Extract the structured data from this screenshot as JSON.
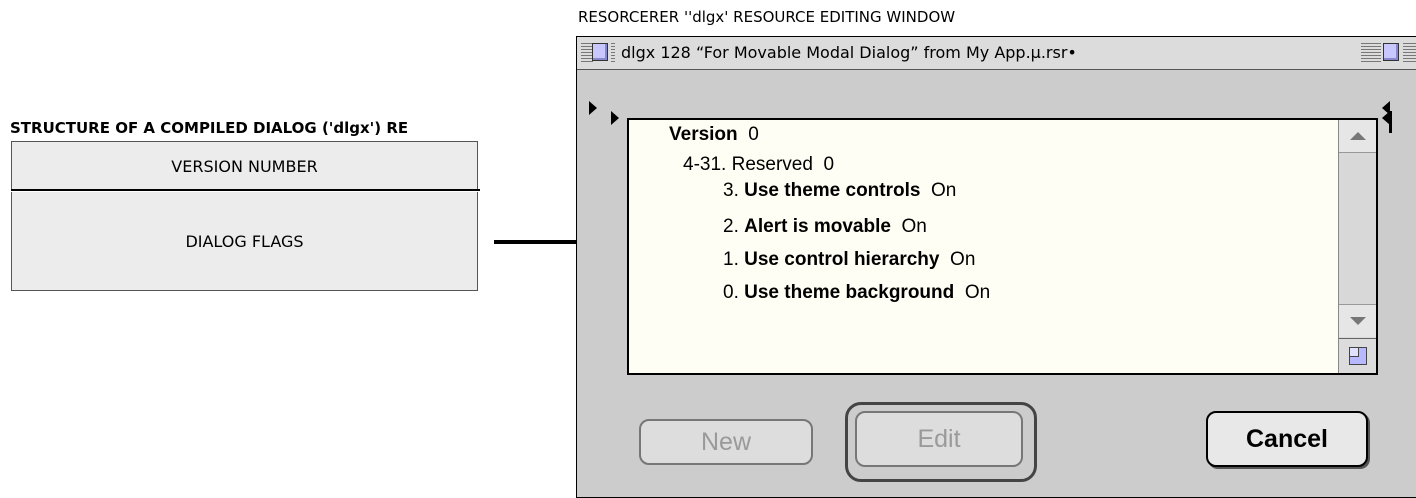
{
  "structure": {
    "title": "STRUCTURE OF A COMPILED DIALOG ('dlgx') RE",
    "fields": [
      "VERSION NUMBER",
      "DIALOG FLAGS"
    ]
  },
  "window_caption": "RESORCERER ''dlgx' RESOURCE EDITING WINDOW",
  "window": {
    "title": "dlgx 128 “For Movable Modal Dialog” from My App.µ.rsr•",
    "lines": [
      {
        "num": "",
        "label": "Version",
        "value": "0",
        "bold_label": true
      },
      {
        "num": "4-31.",
        "label": "Reserved",
        "value": "0",
        "bold_label": false
      },
      {
        "num": "3.",
        "label": "Use theme controls",
        "value": "On",
        "bold_label": true
      },
      {
        "num": "2.",
        "label": "Alert is movable",
        "value": "On",
        "bold_label": true
      },
      {
        "num": "1.",
        "label": "Use control hierarchy",
        "value": "On",
        "bold_label": true
      },
      {
        "num": "0.",
        "label": "Use theme background",
        "value": "On",
        "bold_label": true
      }
    ],
    "buttons": {
      "new": "New",
      "edit": "Edit",
      "cancel": "Cancel"
    }
  },
  "colors": {
    "content_bg": "#fffef4",
    "box_fill": "#ececec",
    "window_bg": "#cccccc"
  }
}
